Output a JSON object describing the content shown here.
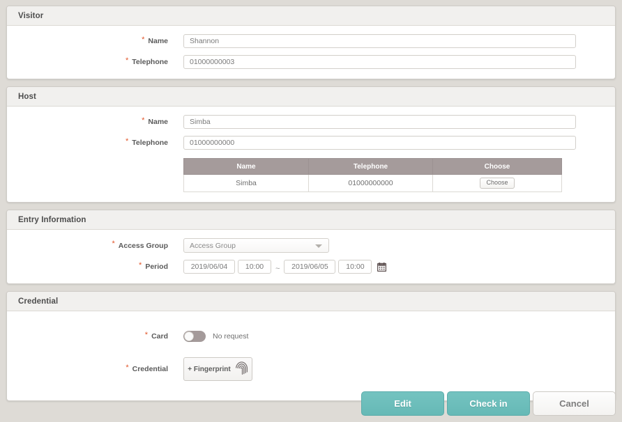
{
  "sections": {
    "visitor": {
      "title": "Visitor",
      "fields": {
        "name_label": "Name",
        "name_value": "Shannon",
        "telephone_label": "Telephone",
        "telephone_value": "01000000003"
      }
    },
    "host": {
      "title": "Host",
      "fields": {
        "name_label": "Name",
        "name_value": "Simba",
        "telephone_label": "Telephone",
        "telephone_value": "01000000000"
      },
      "table": {
        "headers": [
          "Name",
          "Telephone",
          "Choose"
        ],
        "rows": [
          {
            "name": "Simba",
            "telephone": "01000000000",
            "choose_label": "Choose"
          }
        ]
      }
    },
    "entry_information": {
      "title": "Entry Information",
      "fields": {
        "access_group_label": "Access Group",
        "access_group_value": "Access Group",
        "period_label": "Period",
        "start_date": "2019/06/04",
        "start_time": "10:00",
        "range_separator": "~",
        "end_date": "2019/06/05",
        "end_time": "10:00"
      }
    },
    "credential": {
      "title": "Credential",
      "fields": {
        "card_label": "Card",
        "card_toggle_state": "off",
        "card_toggle_text": "No request",
        "credential_label": "Credential",
        "fingerprint_button_label": "+ Fingerprint"
      }
    }
  },
  "footer": {
    "edit_label": "Edit",
    "checkin_label": "Check in",
    "cancel_label": "Cancel"
  },
  "required_marker": "*",
  "colors": {
    "page_background": "#dedbd6",
    "accent_teal": "#6cc0be",
    "required_red": "#e2562a",
    "table_header": "#a59b9b",
    "header_bar": "#f1f0ee"
  }
}
